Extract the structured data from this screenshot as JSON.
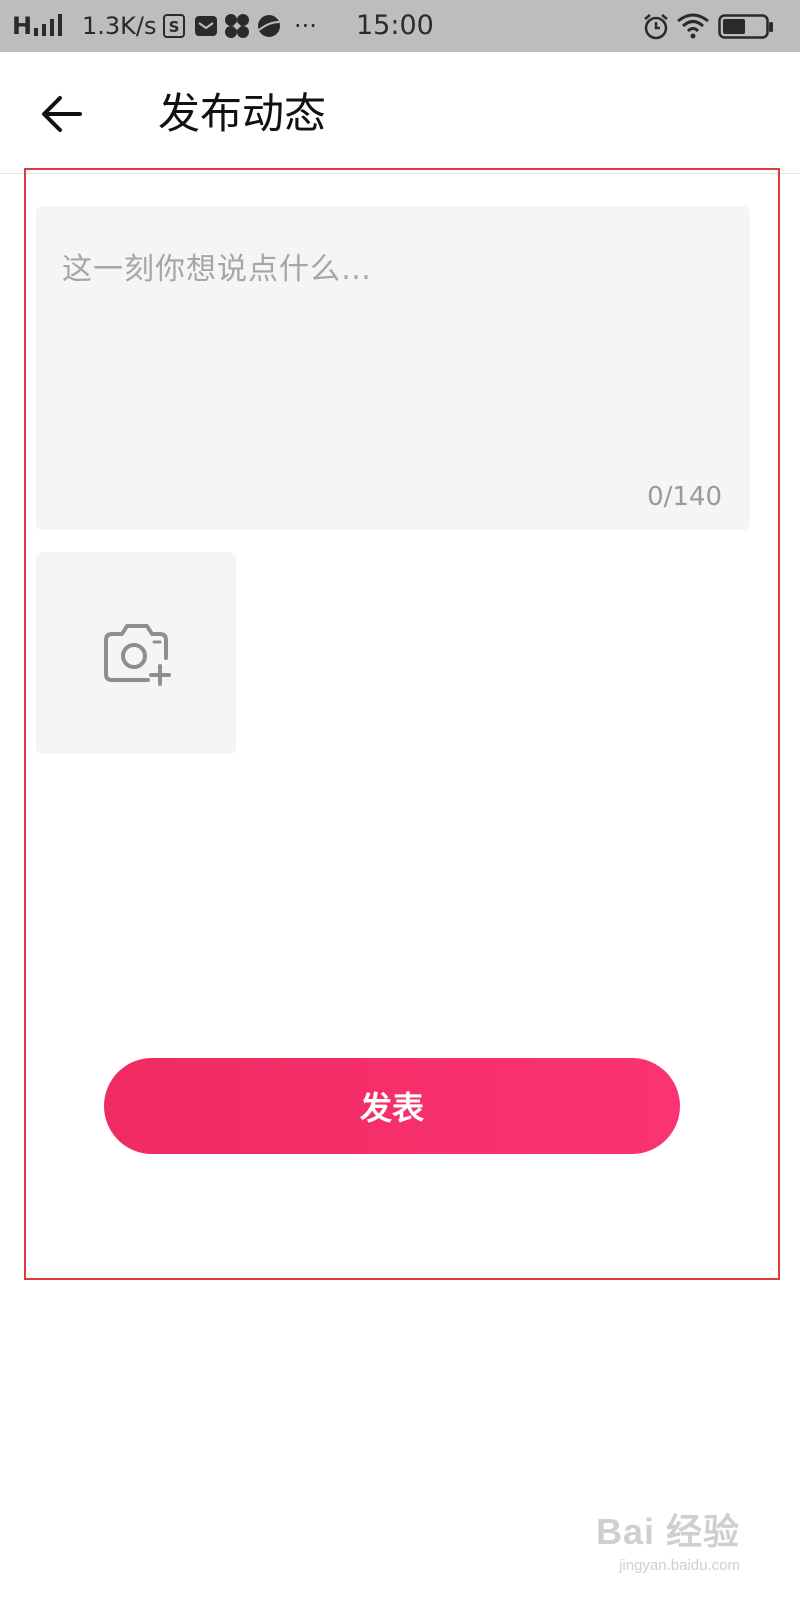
{
  "status_bar": {
    "network_type": "H",
    "speed": "1.3K/s",
    "time": "15:00",
    "more": "···"
  },
  "header": {
    "title": "发布动态",
    "back_icon": "arrow-left-icon"
  },
  "composer": {
    "placeholder": "这一刻你想说点什么…",
    "char_count": "0/140",
    "add_photo_icon": "camera-plus-icon"
  },
  "actions": {
    "publish_label": "发表"
  },
  "colors": {
    "accent": "#f52e68",
    "status_bar_bg": "#bdbdbd",
    "input_bg": "#f5f5f5",
    "annotation": "#e03a3a"
  },
  "watermark": {
    "logo": "Bai 经验",
    "url": "jingyan.baidu.com"
  }
}
